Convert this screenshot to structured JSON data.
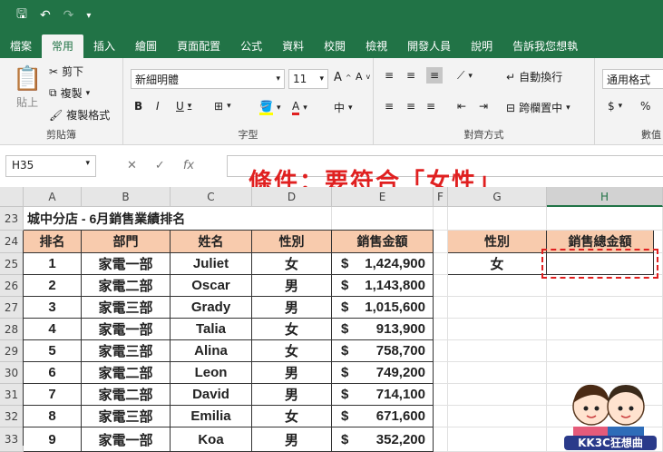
{
  "ribbon_tabs": [
    "檔案",
    "常用",
    "插入",
    "繪圖",
    "頁面配置",
    "公式",
    "資料",
    "校閱",
    "檢視",
    "開發人員",
    "說明",
    "告訴我您想執"
  ],
  "active_tab": "常用",
  "clipboard": {
    "paste": "貼上",
    "cut": "剪下",
    "copy": "複製",
    "format_painter": "複製格式",
    "label": "剪貼簿"
  },
  "font": {
    "name": "新細明體",
    "size": "11",
    "label": "字型"
  },
  "alignment": {
    "wrap": "自動換行",
    "merge": "跨欄置中",
    "label": "對齊方式"
  },
  "number": {
    "format": "通用格式",
    "label": "數值"
  },
  "name_box": "H35",
  "fx_label": "fx",
  "overlay_title": "條件：要符合「女性」",
  "columns": [
    "A",
    "B",
    "C",
    "D",
    "E",
    "F",
    "G",
    "H"
  ],
  "rows": [
    "23",
    "24",
    "25",
    "26",
    "27",
    "28",
    "29",
    "30",
    "31",
    "32",
    "33"
  ],
  "sheet_title": "城中分店 - 6月銷售業績排名",
  "table_headers": [
    "排名",
    "部門",
    "姓名",
    "性別",
    "銷售金額"
  ],
  "table_rows": [
    [
      "1",
      "家電一部",
      "Juliet",
      "女",
      "$",
      "1,424,900"
    ],
    [
      "2",
      "家電二部",
      "Oscar",
      "男",
      "$",
      "1,143,800"
    ],
    [
      "3",
      "家電三部",
      "Grady",
      "男",
      "$",
      "1,015,600"
    ],
    [
      "4",
      "家電一部",
      "Talia",
      "女",
      "$",
      "913,900"
    ],
    [
      "5",
      "家電三部",
      "Alina",
      "女",
      "$",
      "758,700"
    ],
    [
      "6",
      "家電二部",
      "Leon",
      "男",
      "$",
      "749,200"
    ],
    [
      "7",
      "家電二部",
      "David",
      "男",
      "$",
      "714,100"
    ],
    [
      "8",
      "家電三部",
      "Emilia",
      "女",
      "$",
      "671,600"
    ],
    [
      "9",
      "家電一部",
      "Koa",
      "男",
      "$",
      "352,200"
    ]
  ],
  "criteria": {
    "header_gender": "性別",
    "header_total": "銷售總金額",
    "value_gender": "女",
    "value_total": ""
  },
  "logo_text": "KK3C狂想曲",
  "colors": {
    "excel_green": "#217346",
    "header_fill": "#f8cbad",
    "highlight_red": "#e02020"
  }
}
